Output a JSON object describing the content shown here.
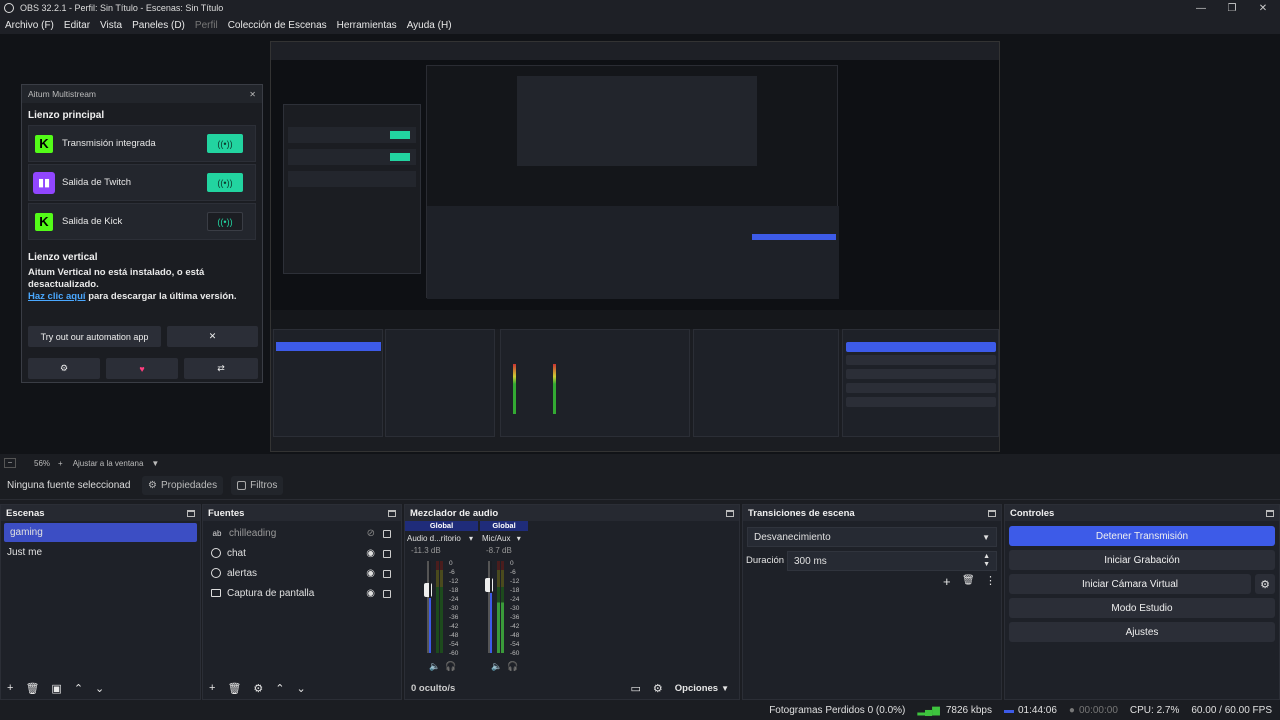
{
  "window": {
    "title": "OBS 32.2.1 - Perfil: Sin Título - Escenas: Sin Título"
  },
  "menu": [
    {
      "label": "Archivo (F)",
      "disabled": false
    },
    {
      "label": "Editar",
      "disabled": false
    },
    {
      "label": "Vista",
      "disabled": false
    },
    {
      "label": "Paneles (D)",
      "disabled": false
    },
    {
      "label": "Perfil",
      "disabled": true
    },
    {
      "label": "Colección de Escenas",
      "disabled": false
    },
    {
      "label": "Herramientas",
      "disabled": false
    },
    {
      "label": "Ayuda (H)",
      "disabled": false
    }
  ],
  "aitum": {
    "title": "Aitum Multistream",
    "main_canvas_title": "Lienzo principal",
    "outputs": [
      {
        "label": "Transmisión integrada",
        "platform": "kick",
        "enabled": true
      },
      {
        "label": "Salida de Twitch",
        "platform": "twitch",
        "enabled": true
      },
      {
        "label": "Salida de Kick",
        "platform": "kick",
        "enabled": false
      }
    ],
    "vertical_title": "Lienzo vertical",
    "vertical_msg": "Aitum Vertical no está instalado, o está desactualizado.",
    "link_text": "Haz clic aquí",
    "link_rest": " para descargar la última versión.",
    "automation_button": "Try out our automation app",
    "close_symbol": "✕"
  },
  "zoom": {
    "value": "56%",
    "fit_label": "Ajustar a la ventana"
  },
  "source_toolbar": {
    "no_source": "Ninguna fuente seleccionad",
    "properties": "Propiedades",
    "filters": "Filtros"
  },
  "scenes": {
    "title": "Escenas",
    "items": [
      {
        "label": "gaming",
        "selected": true
      },
      {
        "label": "Just me",
        "selected": false
      }
    ]
  },
  "sources": {
    "title": "Fuentes",
    "items": [
      {
        "label": "chilleading",
        "icon": "text-icon",
        "visible": false
      },
      {
        "label": "chat",
        "icon": "browser-globe-icon",
        "visible": true
      },
      {
        "label": "alertas",
        "icon": "browser-globe-icon",
        "visible": true
      },
      {
        "label": "Captura de pantalla",
        "icon": "monitor-icon",
        "visible": true
      }
    ]
  },
  "mixer": {
    "title": "Mezclador de audio",
    "channels": [
      {
        "global": "Global",
        "name": "Audio d...ritorio",
        "db": "-11.3 dB",
        "volume": 0.68
      },
      {
        "global": "Global",
        "name": "Mic/Aux",
        "db": "-8.7 dB",
        "volume": 0.74
      }
    ],
    "scale": [
      "0",
      "-6",
      "-12",
      "-18",
      "-24",
      "-30",
      "-36",
      "-42",
      "-48",
      "-54",
      "-60"
    ],
    "hidden": "0 oculto/s",
    "options": "Opciones"
  },
  "transitions": {
    "title": "Transiciones de escena",
    "selected": "Desvanecimiento",
    "duration_label": "Duración",
    "duration_value": "300 ms"
  },
  "controls": {
    "title": "Controles",
    "buttons": [
      {
        "label": "Detener Transmisión",
        "active": true
      },
      {
        "label": "Iniciar Grabación",
        "active": false
      },
      {
        "label": "Iniciar Cámara Virtual",
        "active": false
      },
      {
        "label": "Modo Estudio",
        "active": false
      },
      {
        "label": "Ajustes",
        "active": false
      }
    ]
  },
  "status": {
    "dropped": "Fotogramas Perdidos 0 (0.0%)",
    "bitrate": "7826 kbps",
    "stream_time": "01:44:06",
    "rec_time": "00:00:00",
    "cpu": "CPU: 2.7%",
    "fps": "60.00 / 60.00 FPS"
  },
  "colors": {
    "accent": "#3d5be8",
    "kick_green": "#53fc18",
    "twitch_purple": "#9146ff",
    "toggle_on": "#22d4a0"
  }
}
